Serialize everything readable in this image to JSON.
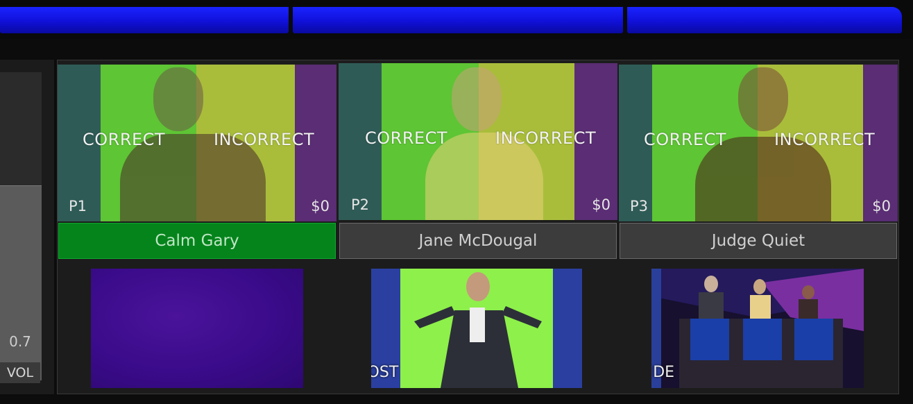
{
  "volume": {
    "value": "0.7",
    "label": "VOL",
    "level": 0.7
  },
  "players": [
    {
      "id": "P1",
      "name": "Calm Gary",
      "correct_label": "CORRECT",
      "incorrect_label": "INCORRECT",
      "score": "$0",
      "active": true
    },
    {
      "id": "P2",
      "name": "Jane McDougal",
      "correct_label": "CORRECT",
      "incorrect_label": "INCORRECT",
      "score": "$0",
      "active": false
    },
    {
      "id": "P3",
      "name": "Judge Quiet",
      "correct_label": "CORRECT",
      "incorrect_label": "INCORRECT",
      "score": "$0",
      "active": false
    }
  ],
  "cameras": [
    {
      "label": ""
    },
    {
      "label": "HOST"
    },
    {
      "label": "WIDE"
    }
  ],
  "colors": {
    "active_name_bar": "#05841c",
    "correct_band": "#5ec534",
    "incorrect_band": "#a9bd3b",
    "left_band": "#2f5b56",
    "right_band": "#5a2d74",
    "top_strip": "#1a24ff"
  }
}
